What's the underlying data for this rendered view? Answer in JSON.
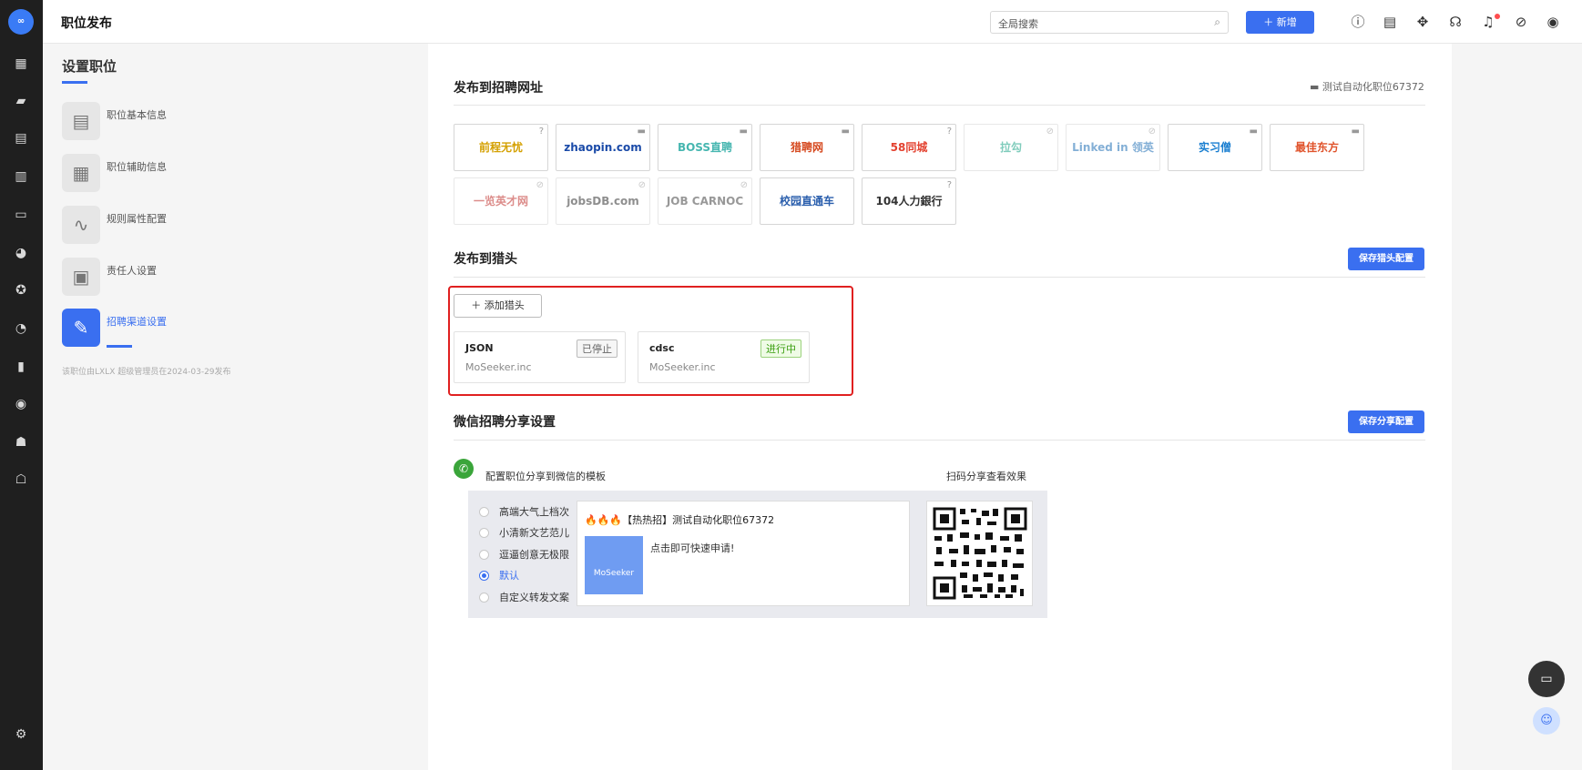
{
  "app": {
    "logo_text": "∞"
  },
  "topbar": {
    "title": "职位发布",
    "search_placeholder": "全局搜索",
    "new_label": "新增"
  },
  "rail_icons": [
    "dashboard-icon",
    "briefcase-icon",
    "resume-icon",
    "calendar-icon",
    "id-card-icon",
    "wechat-icon",
    "star-icon",
    "pie-chart-icon",
    "bar-chart-icon",
    "user-circle-icon",
    "users-icon",
    "user-settings-icon",
    "settings-icon"
  ],
  "topbar_icons": [
    "help-icon",
    "document-icon",
    "puzzle-icon",
    "headset-icon",
    "bell-icon",
    "compass-icon",
    "account-icon"
  ],
  "panel": {
    "heading": "设置职位",
    "steps": [
      {
        "label": "职位基本信息",
        "icon": "▤"
      },
      {
        "label": "职位辅助信息",
        "icon": "▦"
      },
      {
        "label": "规则属性配置",
        "icon": "∿"
      },
      {
        "label": "责任人设置",
        "icon": "▣"
      },
      {
        "label": "招聘渠道设置",
        "icon": "✎"
      }
    ],
    "footer": "该职位由LXLX 超级管理员在2024-03-29发布"
  },
  "publish_sites": {
    "title": "发布到招聘网址",
    "job_tag": "测试自动化职位67372",
    "sites": [
      {
        "name": "前程无忧",
        "color": "#d4a000",
        "mark": "?"
      },
      {
        "name": "zhaopin.com",
        "color": "#1a4aa8",
        "mark": "▬"
      },
      {
        "name": "BOSS直聘",
        "color": "#46b6b0",
        "mark": "▬"
      },
      {
        "name": "猎聘网",
        "color": "#d64a20",
        "mark": "▬"
      },
      {
        "name": "58同城",
        "color": "#e3412f",
        "mark": "?"
      },
      {
        "name": "拉勾",
        "color": "#19a486",
        "mark": "⊘"
      },
      {
        "name": "Linked in 领英",
        "color": "#1f6fb5",
        "mark": "⊘"
      },
      {
        "name": "实习僧",
        "color": "#1b7fd0",
        "mark": "▬"
      },
      {
        "name": "最佳东方",
        "color": "#e0532b",
        "mark": "▬"
      },
      {
        "name": "一览英才网",
        "color": "#c0302b",
        "mark": "⊘"
      },
      {
        "name": "jobsDB.com",
        "color": "#333333",
        "mark": "⊘"
      },
      {
        "name": "JOB CARNOC",
        "color": "#444444",
        "mark": "⊘"
      },
      {
        "name": "校园直通车",
        "color": "#2b5fad",
        "mark": ""
      },
      {
        "name": "104人力銀行",
        "color": "#333333",
        "mark": "?"
      }
    ]
  },
  "headhunter": {
    "title": "发布到猎头",
    "save_label": "保存猎头配置",
    "add_label": "添加猎头",
    "cards": [
      {
        "name": "JSON",
        "company": "MoSeeker.inc",
        "status": "已停止"
      },
      {
        "name": "cdsc",
        "company": "MoSeeker.inc",
        "status": "进行中"
      }
    ]
  },
  "wechat_share": {
    "title": "微信招聘分享设置",
    "save_label": "保存分享配置",
    "template_label": "配置职位分享到微信的模板",
    "qr_label": "扫码分享查看效果",
    "options": [
      "高端大气上档次",
      "小清新文艺范儿",
      "逗逼创意无极限",
      "默认",
      "自定义转发文案"
    ],
    "selected_index": 3,
    "preview_title": "🔥🔥🔥【热热招】测试自动化职位67372",
    "preview_text": "点击即可快速申请!",
    "preview_logo": "MoSeeker"
  }
}
